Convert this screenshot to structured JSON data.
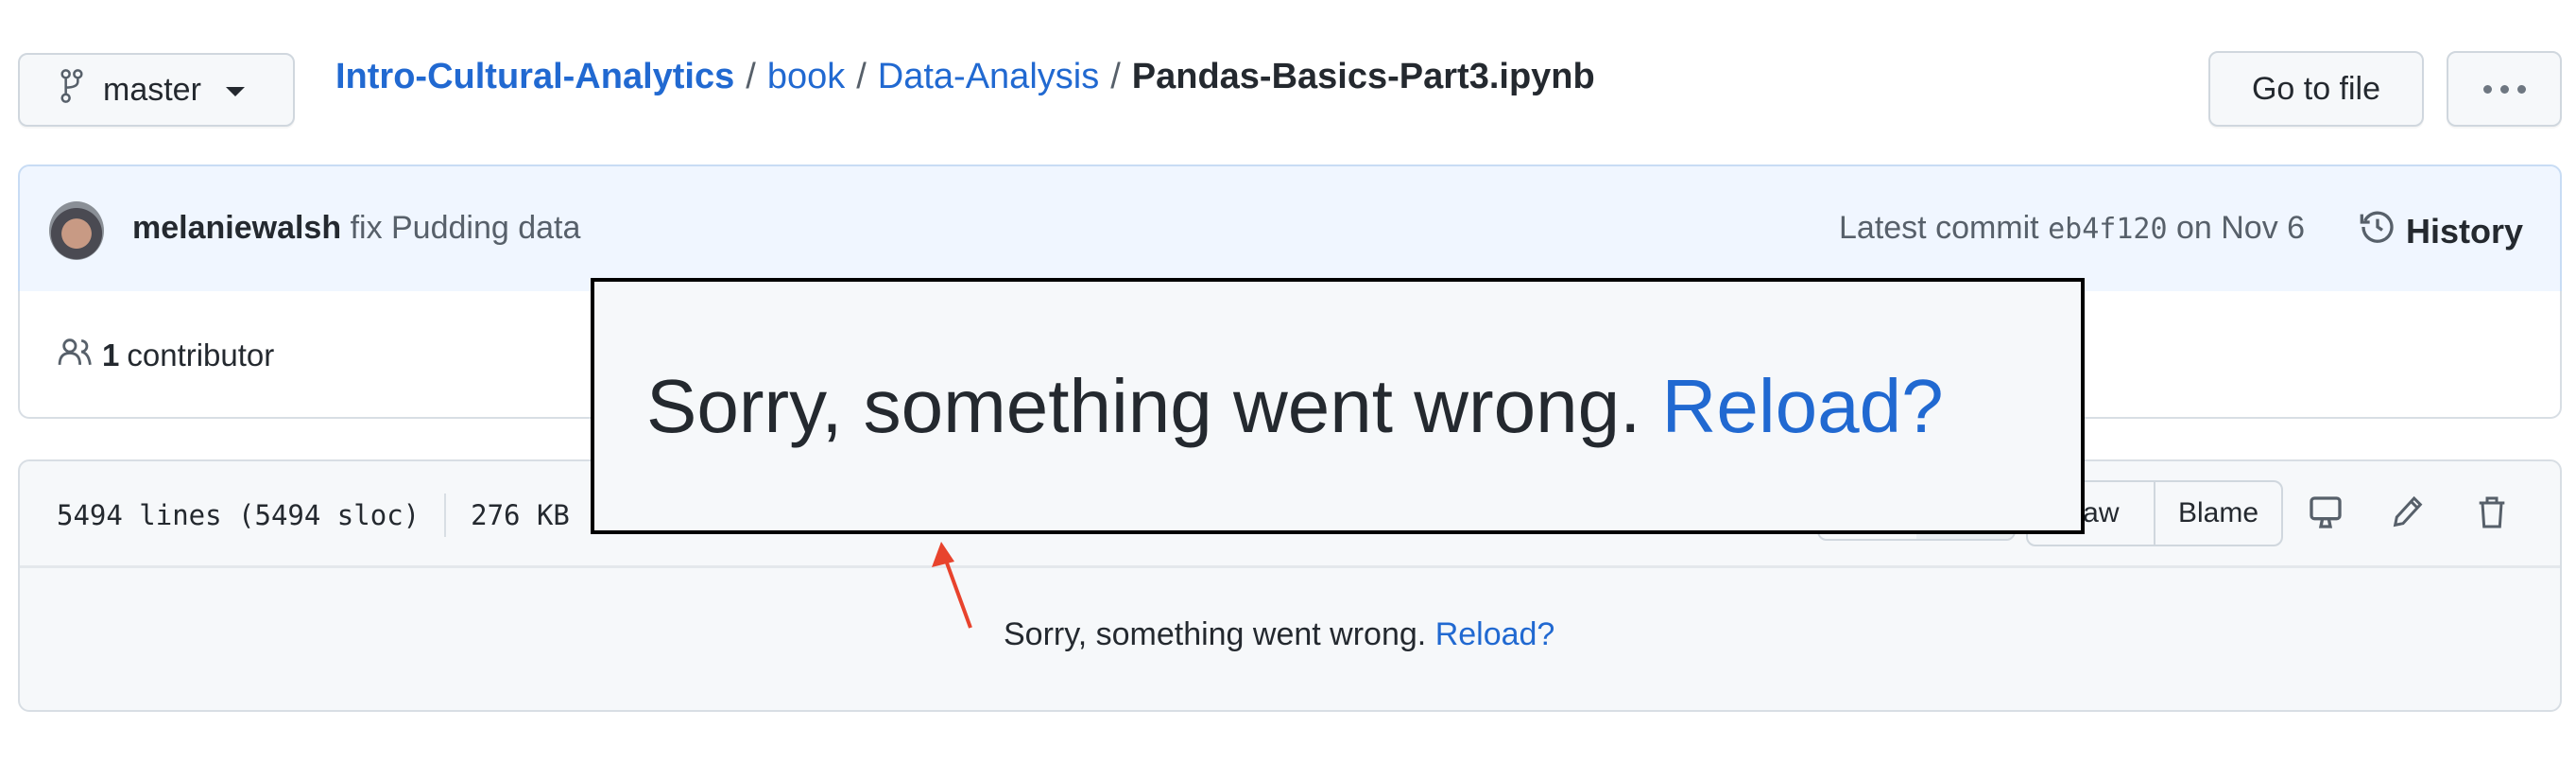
{
  "branch": {
    "name": "master",
    "icon": "git-branch-icon"
  },
  "breadcrumb": {
    "items": [
      "Intro-Cultural-Analytics",
      "book",
      "Data-Analysis"
    ],
    "separator": "/",
    "current_file": "Pandas-Basics-Part3.ipynb"
  },
  "header_actions": {
    "goto_file_label": "Go to file",
    "more_icon": "kebab-horizontal-icon"
  },
  "commit": {
    "author": "melaniewalsh",
    "message": "fix Pudding data",
    "latest_label": "Latest commit",
    "sha": "eb4f120",
    "date": "on Nov 6",
    "history_label": "History"
  },
  "contributors": {
    "count": "1",
    "label": "contributor"
  },
  "file_info": {
    "lines": "5494 lines (5494 sloc)",
    "size": "276 KB",
    "buttons": [
      "Raw",
      "Blame"
    ],
    "icons": [
      "desktop-icon",
      "pencil-icon",
      "trash-icon"
    ]
  },
  "error": {
    "message": "Sorry, something went wrong.",
    "reload_label": "Reload?"
  },
  "overlay": {
    "message": "Sorry, something went wrong.",
    "reload_label": "Reload?"
  },
  "annotation": {
    "arrow_color": "#e8432d"
  },
  "colors": {
    "link": "#2169d1",
    "commit_bg": "#f0f6ff",
    "file_bg": "#f6f8fa"
  }
}
